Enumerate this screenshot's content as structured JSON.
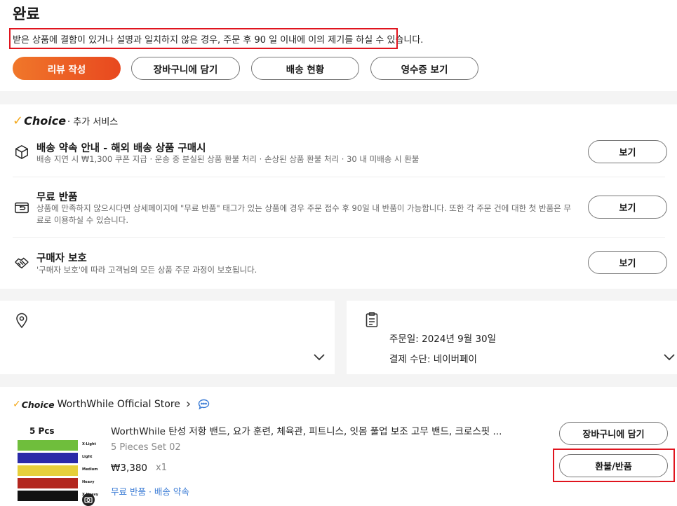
{
  "header": {
    "title": "완료",
    "notice": "받은 상품에 결함이 있거나 설명과 일치하지 않은 경우, 주문 후 90 일 이내에 이의 제기를 하실 수 있습니다."
  },
  "actions": {
    "review": "리뷰 작성",
    "add_to_cart": "장바구니에 담기",
    "shipping_status": "배송 현황",
    "receipt": "영수증 보기"
  },
  "choice": {
    "check_glyph": "✓",
    "brand": "Choice",
    "subtitle": "· 추가 서비스",
    "services": [
      {
        "icon": "package-icon",
        "title": "배송 약속 안내 - 해외 배송 상품 구매시",
        "desc": "배송 지연 시 ₩1,300 쿠폰 지급 · 운송 중 분실된 상품 환불 처리 · 손상된 상품 환불 처리 · 30 내 미배송 시 환불",
        "button": "보기"
      },
      {
        "icon": "return-box-icon",
        "title": "무료 반품",
        "desc": "상품에 만족하지 않으시다면 상세페이지에 \"무료 반품\" 태그가 있는 상품에 경우 주문 접수 후 90일 내 반품이 가능합니다. 또한 각 주문 건에 대한 첫 반품은 무료로 이용하실 수 있습니다.",
        "button": "보기"
      },
      {
        "icon": "handshake-icon",
        "title": "구매자 보호",
        "desc": "'구매자 보호'에 따라 고객님의 모든 상품 주문 과정이 보호됩니다.",
        "button": "보기"
      }
    ]
  },
  "order_info": {
    "order_date": "주문일: 2024년 9월 30일",
    "payment": "결제 수단: 네이버페이"
  },
  "store": {
    "brand": "Choice",
    "name": "WorthWhile Official Store",
    "arrow": "›"
  },
  "product": {
    "title": "WorthWhile 탄성 저항 밴드, 요가 훈련, 체육관, 피트니스, 잇몸 풀업 보조 고무 밴드, 크로스핏 ...",
    "sku": "5 Pieces Set 02",
    "price": "₩3,380",
    "qty": "x1",
    "tags": "무료 반품 · 배송 약속",
    "image_label": "5 Pcs",
    "band_labels": [
      "X-Light",
      "Light",
      "Medium",
      "Heavy",
      "X-Heavy"
    ],
    "band_colors": [
      "#6fbe3c",
      "#2a2aa8",
      "#e6cf3b",
      "#b3261e",
      "#111111"
    ],
    "add_to_cart": "장바구니에 담기",
    "refund": "환불/반품"
  },
  "colors": {
    "accent": "#e8481f",
    "highlight": "#e0141e",
    "choice_gold": "#f3a81b",
    "link": "#3a7bd5"
  }
}
